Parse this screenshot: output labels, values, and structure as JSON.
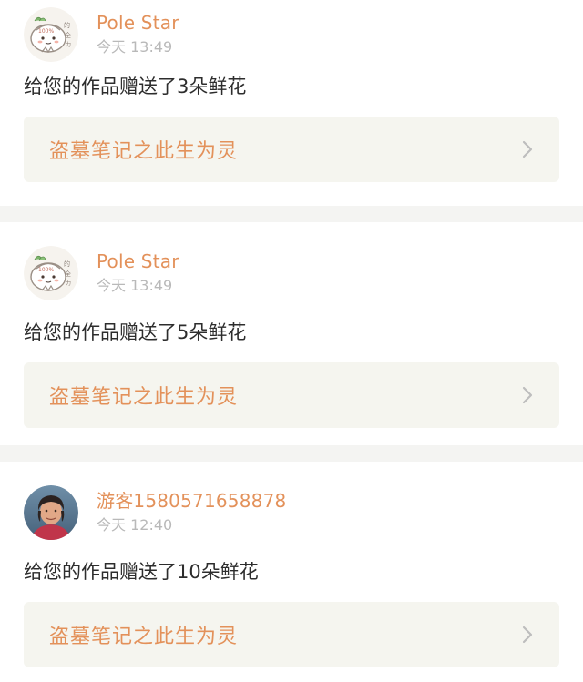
{
  "feed": [
    {
      "user": "Pole Star",
      "time": "今天 13:49",
      "message": "给您的作品赠送了3朵鲜花",
      "work_title": "盗墓笔记之此生为灵",
      "avatar": "cartoon-avatar"
    },
    {
      "user": "Pole Star",
      "time": "今天 13:49",
      "message": "给您的作品赠送了5朵鲜花",
      "work_title": "盗墓笔记之此生为灵",
      "avatar": "cartoon-avatar"
    },
    {
      "user": "游客1580571658878",
      "time": "今天 12:40",
      "message": "给您的作品赠送了10朵鲜花",
      "work_title": "盗墓笔记之此生为灵",
      "avatar": "photo-avatar"
    }
  ],
  "colors": {
    "accent": "#e3915a",
    "time_text": "#b9b9b9",
    "body_text": "#2d2d2d",
    "work_bg": "#f5f5ef",
    "page_bg": "#f4f4f2"
  },
  "icons": {
    "chevron": "chevron-right-icon"
  }
}
